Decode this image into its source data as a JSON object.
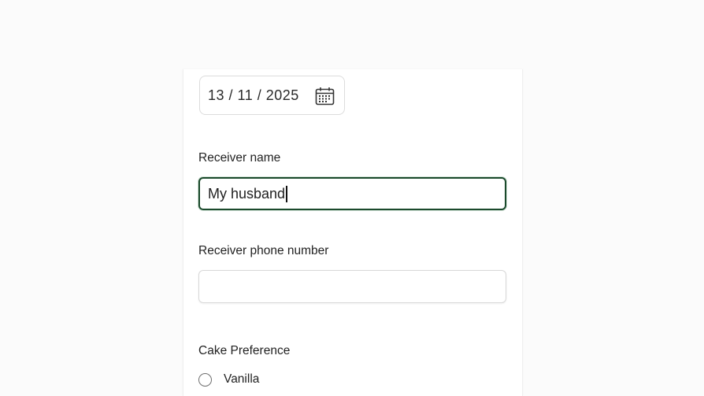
{
  "form": {
    "date": {
      "value": "13 / 11 / 2025",
      "icon": "calendar-icon"
    },
    "receiver_name": {
      "label": "Receiver name",
      "value": "My husband"
    },
    "receiver_phone": {
      "label": "Receiver phone number",
      "value": ""
    },
    "cake_preference": {
      "label": "Cake Preference",
      "options": [
        {
          "label": "Vanilla",
          "selected": false
        }
      ]
    }
  },
  "colors": {
    "focus_border": "#1b4a2c",
    "page_background": "#fbfbfb"
  }
}
